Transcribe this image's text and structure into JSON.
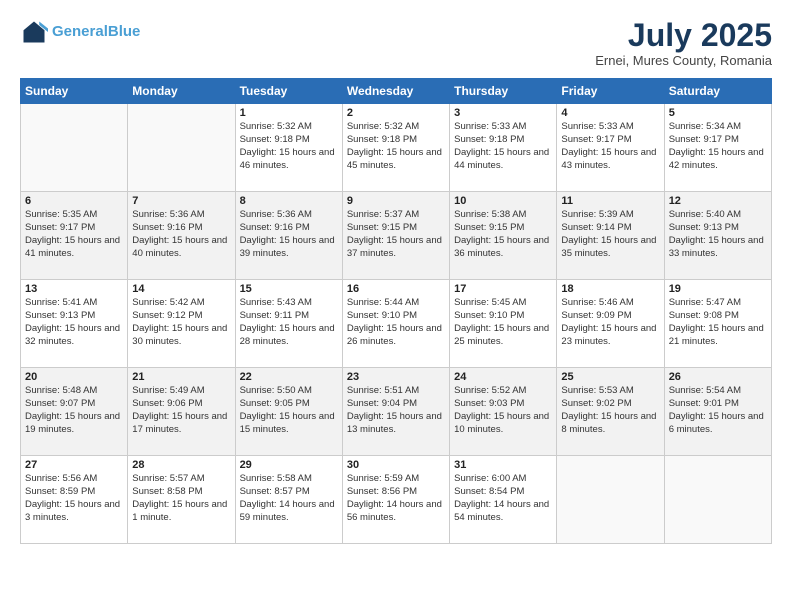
{
  "logo": {
    "line1": "General",
    "line2": "Blue"
  },
  "title": "July 2025",
  "location": "Ernei, Mures County, Romania",
  "days_of_week": [
    "Sunday",
    "Monday",
    "Tuesday",
    "Wednesday",
    "Thursday",
    "Friday",
    "Saturday"
  ],
  "weeks": [
    [
      {
        "day": "",
        "sunrise": "",
        "sunset": "",
        "daylight": ""
      },
      {
        "day": "",
        "sunrise": "",
        "sunset": "",
        "daylight": ""
      },
      {
        "day": "1",
        "sunrise": "Sunrise: 5:32 AM",
        "sunset": "Sunset: 9:18 PM",
        "daylight": "Daylight: 15 hours and 46 minutes."
      },
      {
        "day": "2",
        "sunrise": "Sunrise: 5:32 AM",
        "sunset": "Sunset: 9:18 PM",
        "daylight": "Daylight: 15 hours and 45 minutes."
      },
      {
        "day": "3",
        "sunrise": "Sunrise: 5:33 AM",
        "sunset": "Sunset: 9:18 PM",
        "daylight": "Daylight: 15 hours and 44 minutes."
      },
      {
        "day": "4",
        "sunrise": "Sunrise: 5:33 AM",
        "sunset": "Sunset: 9:17 PM",
        "daylight": "Daylight: 15 hours and 43 minutes."
      },
      {
        "day": "5",
        "sunrise": "Sunrise: 5:34 AM",
        "sunset": "Sunset: 9:17 PM",
        "daylight": "Daylight: 15 hours and 42 minutes."
      }
    ],
    [
      {
        "day": "6",
        "sunrise": "Sunrise: 5:35 AM",
        "sunset": "Sunset: 9:17 PM",
        "daylight": "Daylight: 15 hours and 41 minutes."
      },
      {
        "day": "7",
        "sunrise": "Sunrise: 5:36 AM",
        "sunset": "Sunset: 9:16 PM",
        "daylight": "Daylight: 15 hours and 40 minutes."
      },
      {
        "day": "8",
        "sunrise": "Sunrise: 5:36 AM",
        "sunset": "Sunset: 9:16 PM",
        "daylight": "Daylight: 15 hours and 39 minutes."
      },
      {
        "day": "9",
        "sunrise": "Sunrise: 5:37 AM",
        "sunset": "Sunset: 9:15 PM",
        "daylight": "Daylight: 15 hours and 37 minutes."
      },
      {
        "day": "10",
        "sunrise": "Sunrise: 5:38 AM",
        "sunset": "Sunset: 9:15 PM",
        "daylight": "Daylight: 15 hours and 36 minutes."
      },
      {
        "day": "11",
        "sunrise": "Sunrise: 5:39 AM",
        "sunset": "Sunset: 9:14 PM",
        "daylight": "Daylight: 15 hours and 35 minutes."
      },
      {
        "day": "12",
        "sunrise": "Sunrise: 5:40 AM",
        "sunset": "Sunset: 9:13 PM",
        "daylight": "Daylight: 15 hours and 33 minutes."
      }
    ],
    [
      {
        "day": "13",
        "sunrise": "Sunrise: 5:41 AM",
        "sunset": "Sunset: 9:13 PM",
        "daylight": "Daylight: 15 hours and 32 minutes."
      },
      {
        "day": "14",
        "sunrise": "Sunrise: 5:42 AM",
        "sunset": "Sunset: 9:12 PM",
        "daylight": "Daylight: 15 hours and 30 minutes."
      },
      {
        "day": "15",
        "sunrise": "Sunrise: 5:43 AM",
        "sunset": "Sunset: 9:11 PM",
        "daylight": "Daylight: 15 hours and 28 minutes."
      },
      {
        "day": "16",
        "sunrise": "Sunrise: 5:44 AM",
        "sunset": "Sunset: 9:10 PM",
        "daylight": "Daylight: 15 hours and 26 minutes."
      },
      {
        "day": "17",
        "sunrise": "Sunrise: 5:45 AM",
        "sunset": "Sunset: 9:10 PM",
        "daylight": "Daylight: 15 hours and 25 minutes."
      },
      {
        "day": "18",
        "sunrise": "Sunrise: 5:46 AM",
        "sunset": "Sunset: 9:09 PM",
        "daylight": "Daylight: 15 hours and 23 minutes."
      },
      {
        "day": "19",
        "sunrise": "Sunrise: 5:47 AM",
        "sunset": "Sunset: 9:08 PM",
        "daylight": "Daylight: 15 hours and 21 minutes."
      }
    ],
    [
      {
        "day": "20",
        "sunrise": "Sunrise: 5:48 AM",
        "sunset": "Sunset: 9:07 PM",
        "daylight": "Daylight: 15 hours and 19 minutes."
      },
      {
        "day": "21",
        "sunrise": "Sunrise: 5:49 AM",
        "sunset": "Sunset: 9:06 PM",
        "daylight": "Daylight: 15 hours and 17 minutes."
      },
      {
        "day": "22",
        "sunrise": "Sunrise: 5:50 AM",
        "sunset": "Sunset: 9:05 PM",
        "daylight": "Daylight: 15 hours and 15 minutes."
      },
      {
        "day": "23",
        "sunrise": "Sunrise: 5:51 AM",
        "sunset": "Sunset: 9:04 PM",
        "daylight": "Daylight: 15 hours and 13 minutes."
      },
      {
        "day": "24",
        "sunrise": "Sunrise: 5:52 AM",
        "sunset": "Sunset: 9:03 PM",
        "daylight": "Daylight: 15 hours and 10 minutes."
      },
      {
        "day": "25",
        "sunrise": "Sunrise: 5:53 AM",
        "sunset": "Sunset: 9:02 PM",
        "daylight": "Daylight: 15 hours and 8 minutes."
      },
      {
        "day": "26",
        "sunrise": "Sunrise: 5:54 AM",
        "sunset": "Sunset: 9:01 PM",
        "daylight": "Daylight: 15 hours and 6 minutes."
      }
    ],
    [
      {
        "day": "27",
        "sunrise": "Sunrise: 5:56 AM",
        "sunset": "Sunset: 8:59 PM",
        "daylight": "Daylight: 15 hours and 3 minutes."
      },
      {
        "day": "28",
        "sunrise": "Sunrise: 5:57 AM",
        "sunset": "Sunset: 8:58 PM",
        "daylight": "Daylight: 15 hours and 1 minute."
      },
      {
        "day": "29",
        "sunrise": "Sunrise: 5:58 AM",
        "sunset": "Sunset: 8:57 PM",
        "daylight": "Daylight: 14 hours and 59 minutes."
      },
      {
        "day": "30",
        "sunrise": "Sunrise: 5:59 AM",
        "sunset": "Sunset: 8:56 PM",
        "daylight": "Daylight: 14 hours and 56 minutes."
      },
      {
        "day": "31",
        "sunrise": "Sunrise: 6:00 AM",
        "sunset": "Sunset: 8:54 PM",
        "daylight": "Daylight: 14 hours and 54 minutes."
      },
      {
        "day": "",
        "sunrise": "",
        "sunset": "",
        "daylight": ""
      },
      {
        "day": "",
        "sunrise": "",
        "sunset": "",
        "daylight": ""
      }
    ]
  ]
}
